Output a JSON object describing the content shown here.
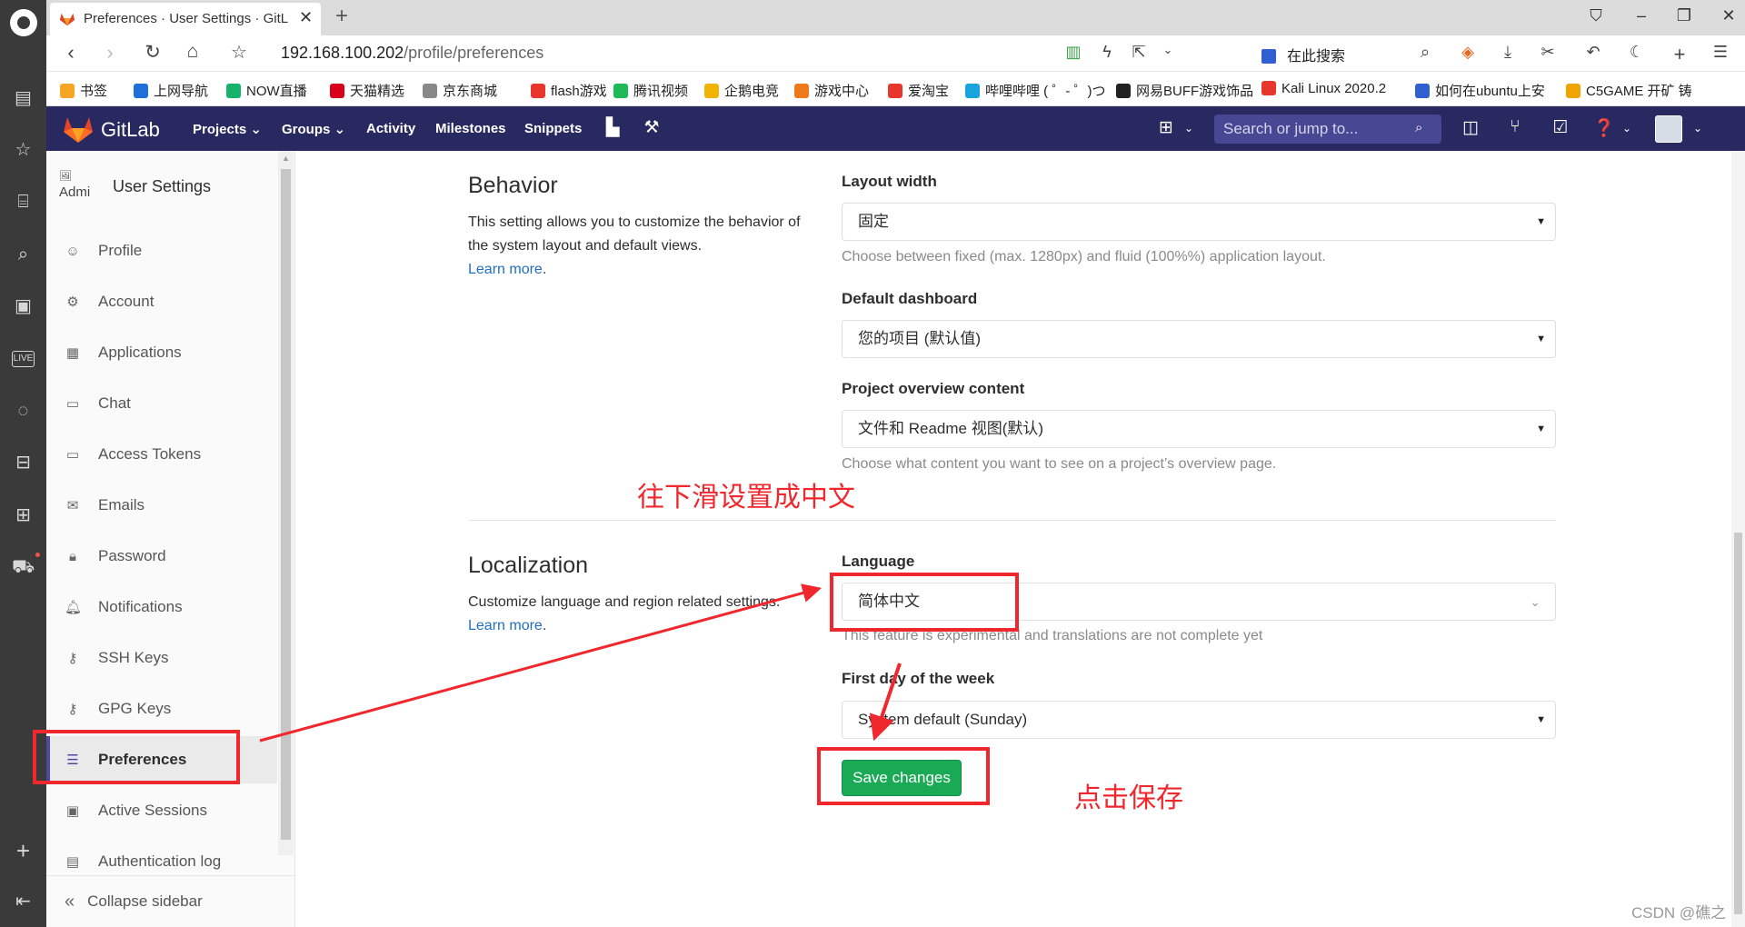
{
  "browser": {
    "tab_title": "Preferences · User Settings · GitLab",
    "url_host": "192.168.100.202",
    "url_path": "/profile/preferences",
    "search_placeholder": "在此搜索",
    "bookmarks": [
      {
        "label": "书签",
        "color": "#f5a623"
      },
      {
        "label": "上网导航",
        "color": "#1e6fd9"
      },
      {
        "label": "NOW直播",
        "color": "#17b36b"
      },
      {
        "label": "天猫精选",
        "color": "#d9001b"
      },
      {
        "label": "京东商城",
        "color": "#888888"
      },
      {
        "label": "flash游戏",
        "color": "#e8362c"
      },
      {
        "label": "腾讯视频",
        "color": "#1dba5a"
      },
      {
        "label": "企鹅电竞",
        "color": "#f0b400"
      },
      {
        "label": "游戏中心",
        "color": "#f07a1a"
      },
      {
        "label": "爱淘宝",
        "color": "#e8362c"
      },
      {
        "label": "哔哩哔哩 ( ゜- ゜)つ",
        "color": "#19a4dc"
      },
      {
        "label": "网易BUFF游戏饰品",
        "color": "#222222"
      },
      {
        "label": "Kali Linux 2020.2",
        "color": "#e8362c"
      },
      {
        "label": "如何在ubuntu上安",
        "color": "#2f5fd0"
      },
      {
        "label": "C5GAME 开矿 铸",
        "color": "#f0a400"
      }
    ]
  },
  "gitlab": {
    "brand": "GitLab",
    "nav": [
      "Projects",
      "Groups",
      "Activity",
      "Milestones",
      "Snippets"
    ],
    "search_placeholder": "Search or jump to..."
  },
  "sidebar": {
    "context_avatar_text": "Admi",
    "context_title": "User Settings",
    "items": [
      {
        "label": "Profile",
        "icon": "profile-icon"
      },
      {
        "label": "Account",
        "icon": "account-icon"
      },
      {
        "label": "Applications",
        "icon": "applications-icon"
      },
      {
        "label": "Chat",
        "icon": "chat-icon"
      },
      {
        "label": "Access Tokens",
        "icon": "token-icon"
      },
      {
        "label": "Emails",
        "icon": "email-icon"
      },
      {
        "label": "Password",
        "icon": "lock-icon"
      },
      {
        "label": "Notifications",
        "icon": "bell-icon"
      },
      {
        "label": "SSH Keys",
        "icon": "key-icon"
      },
      {
        "label": "GPG Keys",
        "icon": "key-icon"
      },
      {
        "label": "Preferences",
        "icon": "preferences-icon"
      },
      {
        "label": "Active Sessions",
        "icon": "monitor-icon"
      },
      {
        "label": "Authentication log",
        "icon": "log-icon"
      }
    ],
    "active_item": "Preferences",
    "collapse_label": "Collapse sidebar"
  },
  "behavior": {
    "title": "Behavior",
    "description": "This setting allows you to customize the behavior of the system layout and default views.",
    "learn_more": "Learn more",
    "layout_width_label": "Layout width",
    "layout_width_value": "固定",
    "layout_width_help": "Choose between fixed (max. 1280px) and fluid (100%%) application layout.",
    "dashboard_label": "Default dashboard",
    "dashboard_value": "您的项目 (默认值)",
    "overview_label": "Project overview content",
    "overview_value": "文件和 Readme 视图(默认)",
    "overview_help": "Choose what content you want to see on a project’s overview page."
  },
  "localization": {
    "title": "Localization",
    "description": "Customize language and region related settings.",
    "learn_more": "Learn more",
    "language_label": "Language",
    "language_value": "简体中文",
    "language_help": "This feature is experimental and translations are not complete yet",
    "week_label": "First day of the week",
    "week_value": "System default (Sunday)",
    "save_label": "Save changes"
  },
  "annotations": {
    "scroll_hint": "往下滑设置成中文",
    "save_hint": "点击保存",
    "color": "#f0272d"
  },
  "watermark": "CSDN @礁之"
}
